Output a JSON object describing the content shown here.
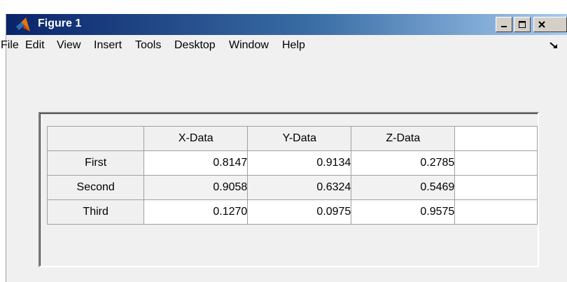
{
  "window": {
    "title": "Figure 1",
    "controls": {
      "minimize": "minimize-icon",
      "maximize": "maximize-icon",
      "close": "close-icon"
    }
  },
  "menubar": {
    "items": [
      "File",
      "Edit",
      "View",
      "Insert",
      "Tools",
      "Desktop",
      "Window",
      "Help"
    ]
  },
  "table": {
    "columns": [
      "X-Data",
      "Y-Data",
      "Z-Data"
    ],
    "rows": [
      {
        "label": "First",
        "values": [
          "0.8147",
          "0.9134",
          "0.2785"
        ]
      },
      {
        "label": "Second",
        "values": [
          "0.9058",
          "0.6324",
          "0.5469"
        ]
      },
      {
        "label": "Third",
        "values": [
          "0.1270",
          "0.0975",
          "0.9575"
        ]
      }
    ]
  },
  "colors": {
    "titlebar_start": "#0a246a",
    "titlebar_end": "#a6caf0",
    "window_bg": "#f0f0f0",
    "cell_bg": "#ffffff",
    "alt_cell_bg": "#f2f2f2"
  }
}
